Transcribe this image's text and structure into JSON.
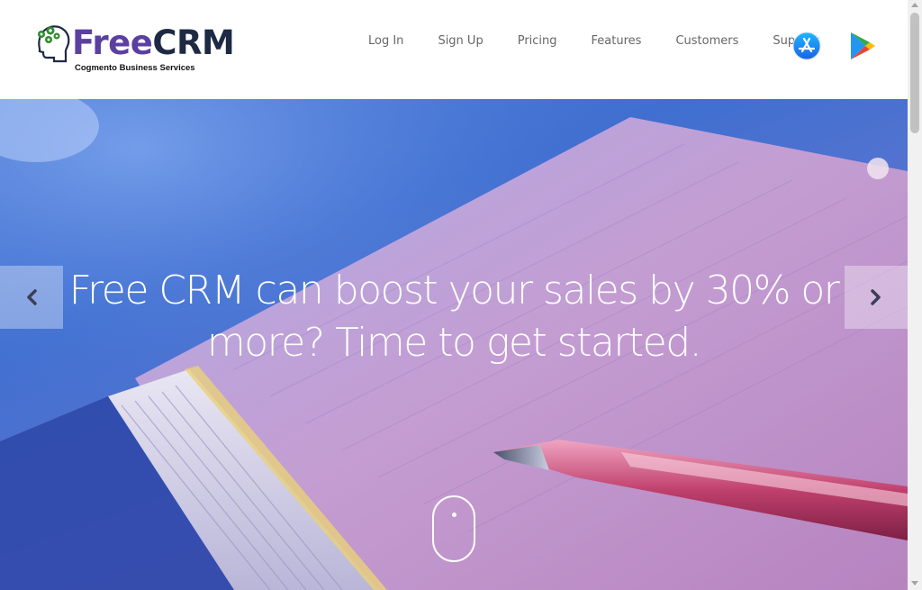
{
  "brand": {
    "name_part1": "Free",
    "name_part2": "CRM",
    "tagline": "Cogmento Business Services"
  },
  "nav": {
    "items": [
      {
        "label": "Log In"
      },
      {
        "label": "Sign Up"
      },
      {
        "label": "Pricing"
      },
      {
        "label": "Features"
      },
      {
        "label": "Customers"
      },
      {
        "label": "Support"
      }
    ]
  },
  "store_icons": [
    "app-store-icon",
    "google-play-icon"
  ],
  "hero": {
    "headline": "Free CRM can boost your sales by 30% or more? Time to get started."
  },
  "colors": {
    "brand_purple": "#5b3fa1",
    "brand_navy": "#1e2a44",
    "nav_text": "#666666",
    "logo_green": "#2e8b2e"
  }
}
